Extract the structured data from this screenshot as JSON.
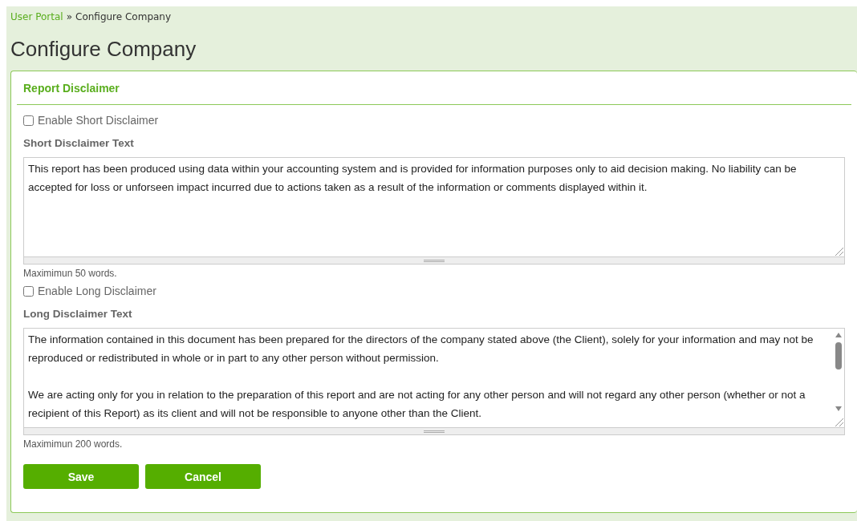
{
  "breadcrumb": {
    "link": "User Portal",
    "separator": "»",
    "current": "Configure Company"
  },
  "title": "Configure Company",
  "panel": {
    "heading": "Report Disclaimer",
    "sections": [
      {
        "checkbox": {
          "label": "Enable Short Disclaimer",
          "checked": false
        },
        "field_label": "Short Disclaimer Text",
        "paragraphs": [
          "This report has been produced using data within your accounting system and is provided for information purposes only to aid decision making. No liability can be accepted for loss or unforseen impact incurred due to actions taken as a result of the information or comments displayed within it."
        ],
        "scrollable": false,
        "hint": "Maximimun 50 words."
      },
      {
        "checkbox": {
          "label": "Enable Long Disclaimer",
          "checked": false
        },
        "field_label": "Long Disclaimer Text",
        "paragraphs": [
          "The information contained in this document has been prepared for the directors of the company stated above (the Client), solely for your information and may not be reproduced or redistributed in whole or in part to any other person without permission.",
          "We are acting only for you in relation to the preparation of this report and are not acting for any other person and will not regard any other person (whether or not a recipient of this Report) as its client and will not be responsible to anyone other than the Client."
        ],
        "scrollable": true,
        "hint": "Maximimun 200 words."
      }
    ],
    "buttons": [
      "Save",
      "Cancel"
    ]
  }
}
